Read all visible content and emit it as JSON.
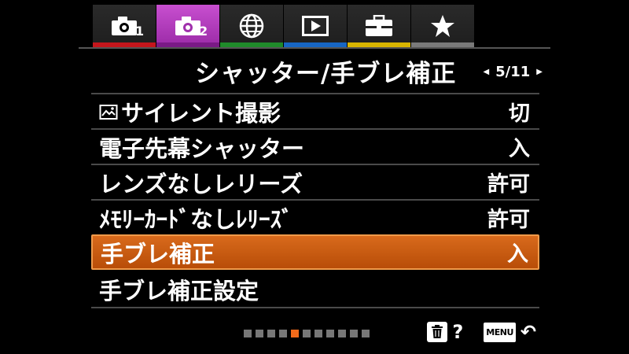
{
  "tabs": [
    {
      "icon": "camera-1-icon",
      "number": "1",
      "stripe": "#c4161c",
      "active": false
    },
    {
      "icon": "camera-2-icon",
      "number": "2",
      "stripe": "#8a1f96",
      "active": true
    },
    {
      "icon": "globe-icon",
      "number": "",
      "stripe": "#1f8a2a",
      "active": false
    },
    {
      "icon": "playback-icon",
      "number": "",
      "stripe": "#1766c4",
      "active": false
    },
    {
      "icon": "toolbox-icon",
      "number": "",
      "stripe": "#d8b400",
      "active": false
    },
    {
      "icon": "star-icon",
      "number": "",
      "stripe": "#7a7a7a",
      "active": false
    }
  ],
  "header": {
    "title": "シャッター/手ブレ補正",
    "page": "5/11"
  },
  "menu": [
    {
      "label": "サイレント撮影",
      "value": "切",
      "icon": "silent-shooting-icon",
      "selected": false
    },
    {
      "label": "電子先幕シャッター",
      "value": "入",
      "selected": false
    },
    {
      "label": "レンズなしレリーズ",
      "value": "許可",
      "selected": false
    },
    {
      "label": "ﾒﾓﾘｰｶｰﾄﾞなしﾚﾘｰｽﾞ",
      "value": "許可",
      "selected": false
    },
    {
      "label": "手ブレ補正",
      "value": "入",
      "selected": true
    },
    {
      "label": "手ブレ補正設定",
      "value": "",
      "selected": false
    }
  ],
  "pagination": {
    "total": 11,
    "current": 5
  },
  "footer": {
    "help": "?",
    "menu_badge": "MENU",
    "back": "↶"
  },
  "colors": {
    "accent": "#d8671a",
    "active_tab": "#b43cbf"
  }
}
